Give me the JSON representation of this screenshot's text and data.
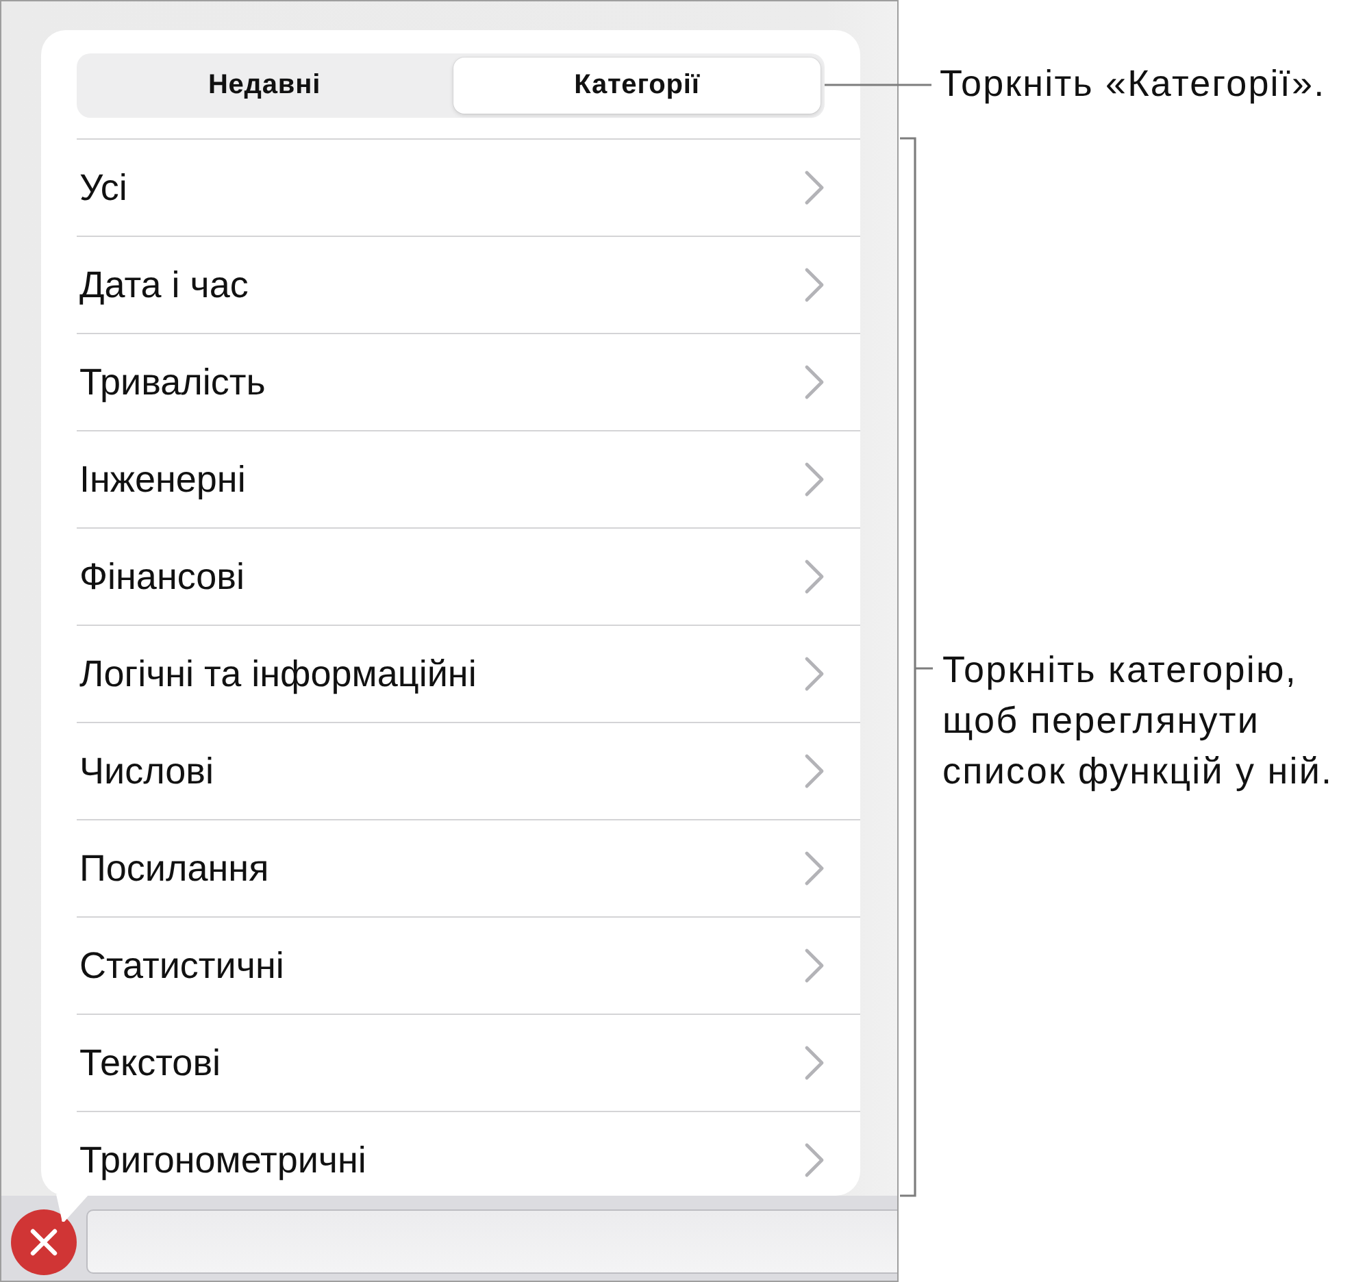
{
  "segmented_control": {
    "segments": [
      {
        "label": "Недавні",
        "selected": false
      },
      {
        "label": "Категорії",
        "selected": true
      }
    ]
  },
  "categories": [
    "Усі",
    "Дата і час",
    "Тривалість",
    "Інженерні",
    "Фінансові",
    "Логічні та інформаційні",
    "Числові",
    "Посилання",
    "Статистичні",
    "Текстові",
    "Тригонометричні"
  ],
  "callouts": [
    {
      "kind": "line",
      "text": "Торкніть «Категорії»."
    },
    {
      "kind": "bracket",
      "text": "Торкніть категорію, щоб переглянути список функцій у ній."
    }
  ]
}
